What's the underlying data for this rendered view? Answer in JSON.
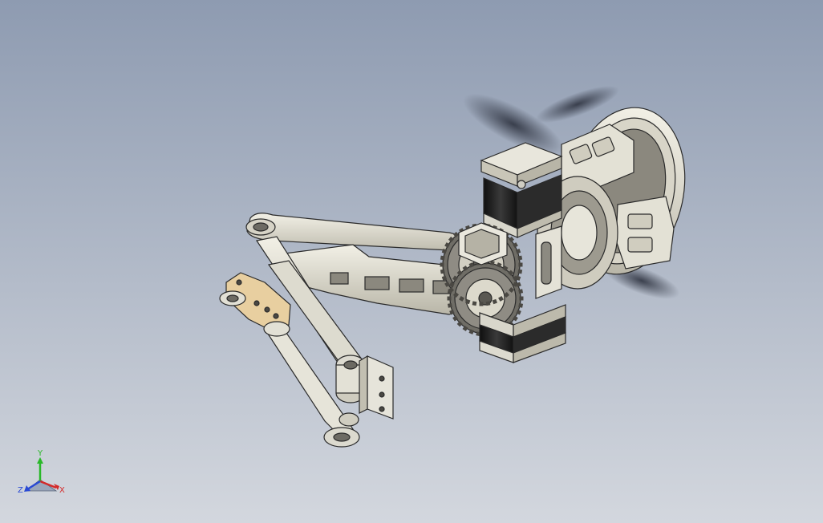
{
  "viewport": {
    "background_top": "#8e9bb1",
    "background_bottom": "#d3d7de"
  },
  "model": {
    "name": "robotic-arm-assembly",
    "colors": {
      "metal_light": "#e6e4d8",
      "metal_mid": "#c9c6b8",
      "metal_dark": "#7d7b72",
      "outline": "#2a2a2a",
      "motor_black": "#1e1e1e",
      "bracket_tan": "#e8cfa0",
      "shadow": "#3a3a3a"
    }
  },
  "triad": {
    "x_label": "X",
    "y_label": "Y",
    "z_label": "Z",
    "x_color": "#d42a2a",
    "y_color": "#2ab82a",
    "z_color": "#2a4ad4"
  }
}
